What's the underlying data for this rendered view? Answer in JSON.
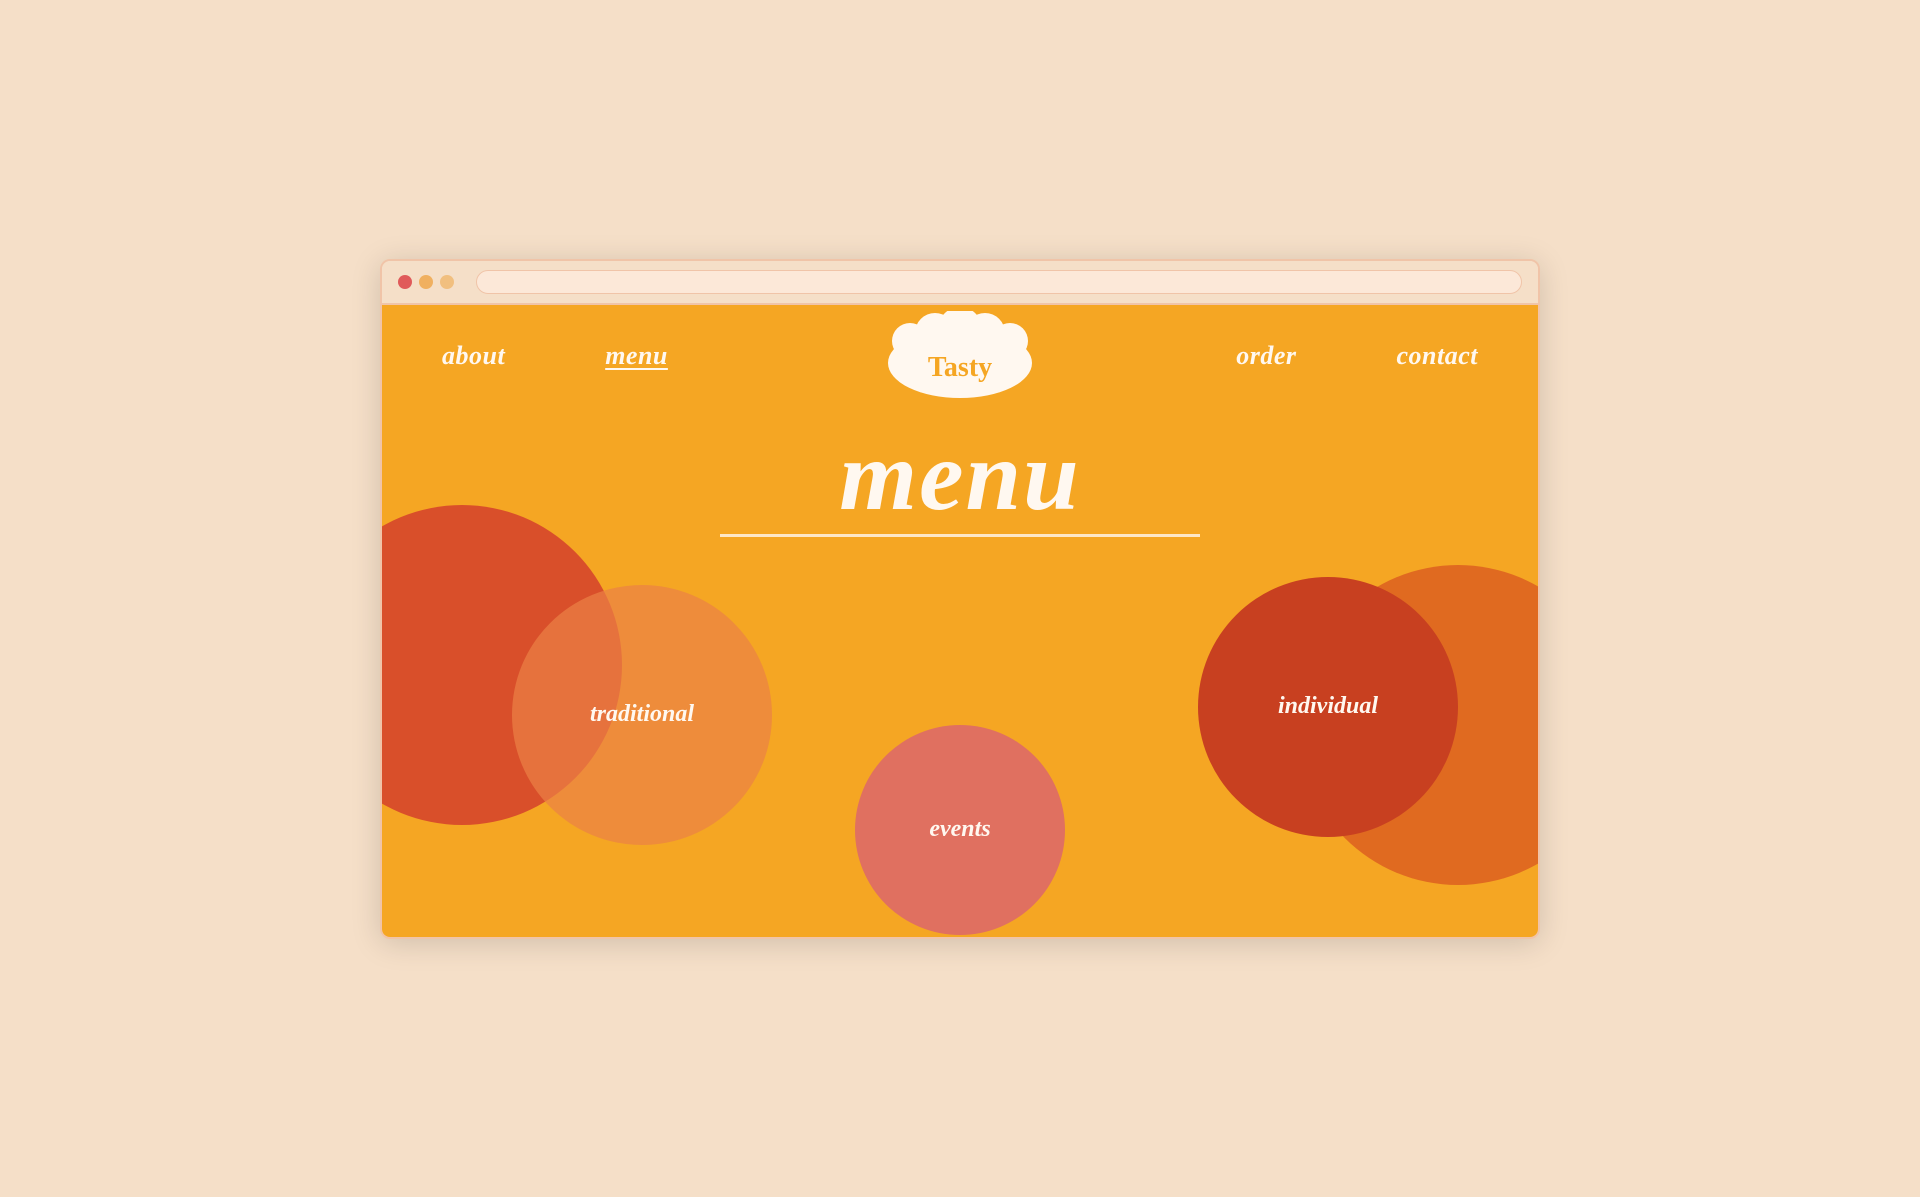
{
  "browser": {
    "dots": [
      "red",
      "yellow",
      "orange"
    ]
  },
  "nav": {
    "items": [
      {
        "id": "about",
        "label": "about",
        "active": false
      },
      {
        "id": "menu",
        "label": "menu",
        "active": true
      }
    ],
    "items_right": [
      {
        "id": "order",
        "label": "order",
        "active": false
      },
      {
        "id": "contact",
        "label": "contact",
        "active": false
      }
    ]
  },
  "logo": {
    "text": "TASTY"
  },
  "page": {
    "title": "menu",
    "subtitle_underline": true
  },
  "circles": [
    {
      "id": "traditional",
      "label": "traditional"
    },
    {
      "id": "events",
      "label": "events"
    },
    {
      "id": "individual",
      "label": "individual"
    }
  ],
  "colors": {
    "background": "#f5dfc8",
    "site_bg": "#f5a623",
    "text_light": "#fff8f0",
    "circle_dark_red": "#d94f2a",
    "circle_orange": "rgba(240,140,80,0.65)",
    "circle_salmon": "#e07060",
    "circle_big_right": "#e06a20",
    "circle_right_dark": "#cc4020"
  }
}
